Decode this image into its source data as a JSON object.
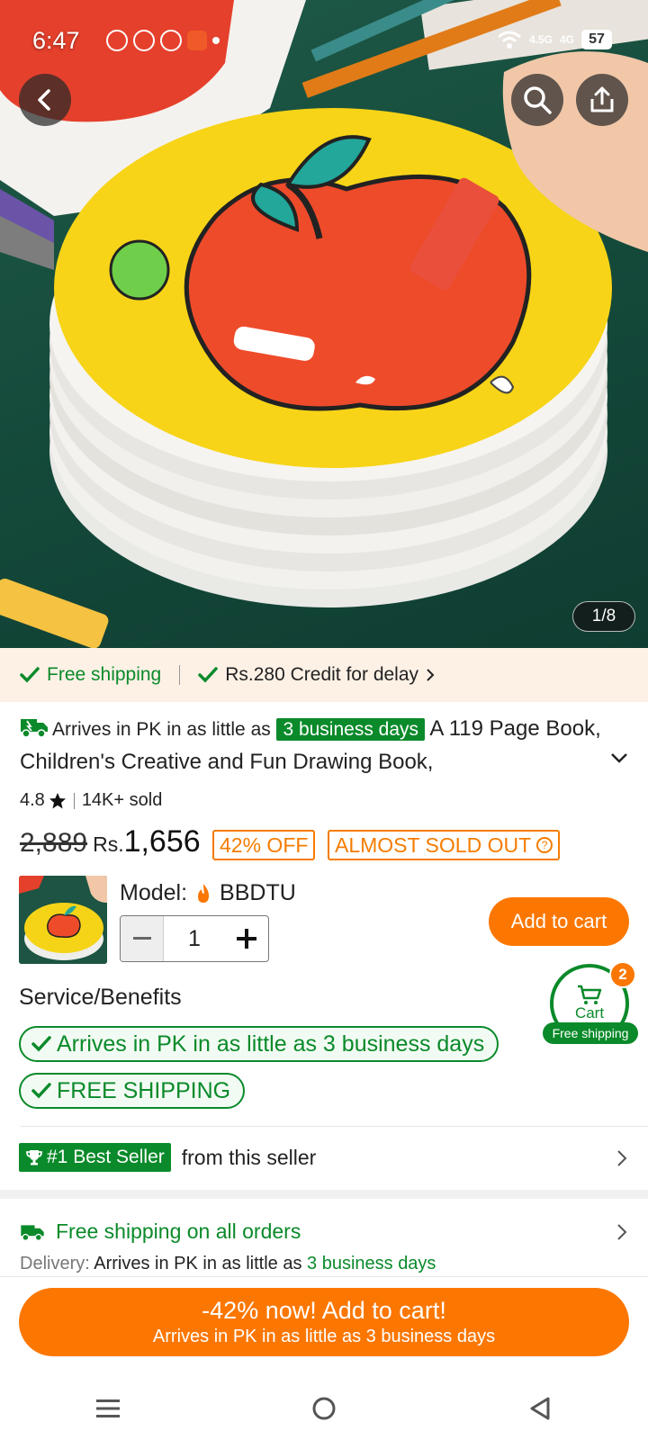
{
  "status_bar": {
    "time": "6:47",
    "net1": "4.5G",
    "net2": "4G",
    "battery": "57"
  },
  "gallery": {
    "counter": "1/8"
  },
  "shipping_strip": {
    "free_shipping": "Free shipping",
    "credit": "Rs.280 Credit for delay"
  },
  "product": {
    "arrives_prefix": "Arrives in PK in as little as",
    "arrives_days": "3 business days",
    "title": "A 119 Page Book, Children's Creative and Fun Drawing Book,",
    "rating": "4.8",
    "sold": "14K+ sold",
    "old_price": "2,889",
    "currency": "Rs.",
    "price": "1,656",
    "discount": "42% OFF",
    "stock_tag": "ALMOST SOLD OUT",
    "model_label": "Model:",
    "model_value": "BBDTU",
    "quantity": "1",
    "add_to_cart": "Add to cart"
  },
  "floating_cart": {
    "label": "Cart",
    "count": "2",
    "free_label": "Free shipping"
  },
  "service": {
    "title": "Service/Benefits",
    "benefits": [
      "Arrives in PK in as little as 3 business days",
      "FREE SHIPPING"
    ]
  },
  "seller": {
    "badge": "#1 Best Seller",
    "text": "from this seller"
  },
  "delivery": {
    "free_all": "Free shipping on all orders",
    "label": "Delivery:",
    "text": "Arrives in PK in as little as",
    "days": "3 business days"
  },
  "cta": {
    "line1": "-42% now! Add to cart!",
    "line2": "Arrives in PK in as little as 3 business days"
  },
  "colors": {
    "accent_orange": "#fb7701",
    "green": "#0a8a2a"
  },
  "icons": [
    "whatsapp-icon",
    "chat-icon",
    "pinwheel-icon",
    "app-icon",
    "wifi-icon",
    "signal-icon",
    "battery-icon",
    "back-icon",
    "search-icon",
    "share-icon",
    "check-icon",
    "chevron-right-icon",
    "truck-icon",
    "chevron-down-icon",
    "star-icon",
    "help-icon",
    "fire-icon",
    "minus-icon",
    "plus-icon",
    "cart-icon",
    "trophy-icon",
    "menu-icon",
    "home-icon",
    "back-triangle-icon"
  ]
}
